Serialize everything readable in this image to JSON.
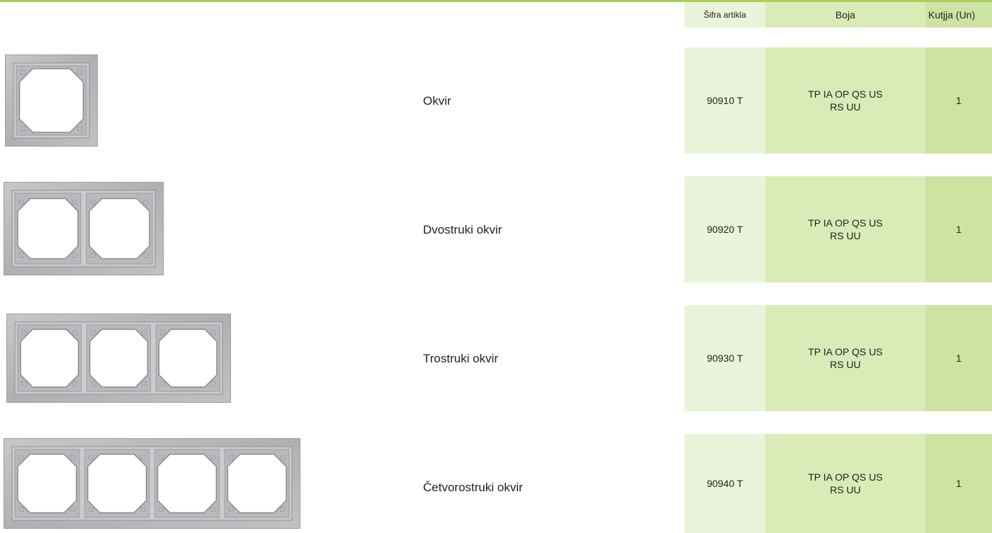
{
  "header": {
    "code": "Šifra artikla",
    "color": "Boja",
    "box": "Kutjja (Un)"
  },
  "products": [
    {
      "name": "Okvir",
      "code": "90910 T",
      "color_line1": "TP IA OP QS US",
      "color_line2": "RS UU",
      "box": "1",
      "gangs": 1
    },
    {
      "name": "Dvostruki okvir",
      "code": "90920 T",
      "color_line1": "TP IA OP QS US",
      "color_line2": "RS UU",
      "box": "1",
      "gangs": 2
    },
    {
      "name": "Trostruki okvir",
      "code": "90930 T",
      "color_line1": "TP IA OP QS US",
      "color_line2": "RS UU",
      "box": "1",
      "gangs": 3
    },
    {
      "name": "Četvorostruki okvir",
      "code": "90940 T",
      "color_line1": "TP IA OP QS US",
      "color_line2": "RS UU",
      "box": "1",
      "gangs": 4
    }
  ],
  "colors": {
    "accent_rule": "#a8d05a",
    "code_cell": "#eaf4da",
    "color_cell": "#d9ecb8",
    "box_cell": "#cde3a2",
    "frame_silver": "#b4b6b8"
  }
}
